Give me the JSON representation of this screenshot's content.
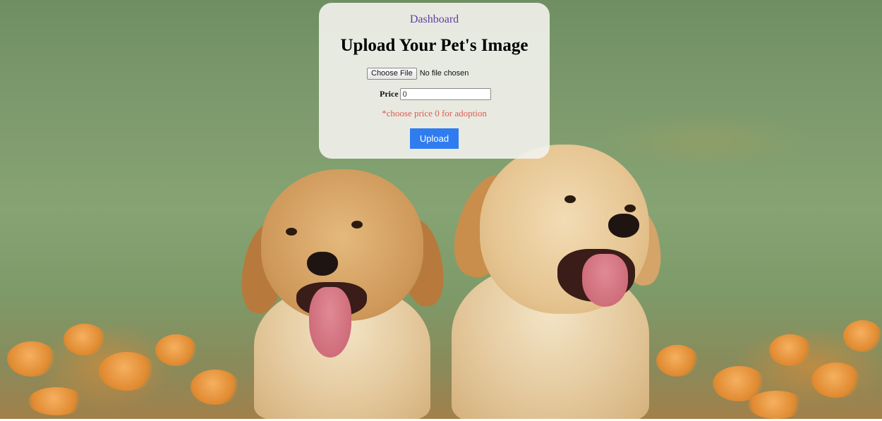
{
  "nav": {
    "dashboard_label": "Dashboard"
  },
  "form": {
    "title": "Upload Your Pet's Image",
    "file_button_label": "Choose File",
    "file_status": "No file chosen",
    "price_label": "Price",
    "price_value": "0",
    "hint": "*choose price 0 for adoption",
    "upload_label": "Upload"
  },
  "colors": {
    "card_background": "#f1f1ec",
    "link": "#5c3f9e",
    "hint": "#e05a4c",
    "upload_button": "#2f7cf0"
  },
  "background": {
    "subject": "two golden retriever puppies in a grass field with orange flowers"
  }
}
